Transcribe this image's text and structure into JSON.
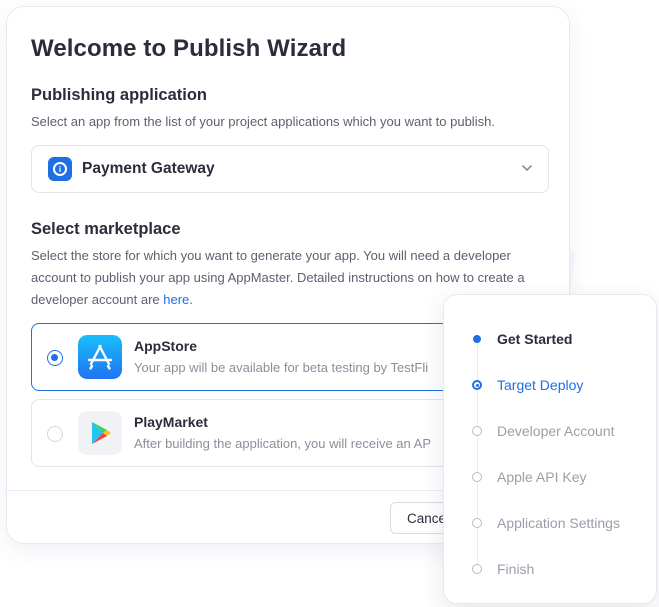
{
  "wizard": {
    "title": "Welcome to Publish Wizard"
  },
  "publishing": {
    "title": "Publishing application",
    "description": "Select an app from the list of your project applications which you want to publish.",
    "selected_app": "Payment Gateway",
    "app_icon": "payment-gateway-icon"
  },
  "marketplace": {
    "title": "Select marketplace",
    "description_part1": "Select the store for which you want to generate your app. You will need a developer account to publish your app using AppMaster. Detailed instructions on how to create a developer account are ",
    "link_text": "here",
    "description_end": ".",
    "options": [
      {
        "name": "AppStore",
        "subtitle": "Your app will be available for beta testing by TestFli",
        "icon": "appstore-icon",
        "selected": true
      },
      {
        "name": "PlayMarket",
        "subtitle": "After building the application, you will receive an AP",
        "icon": "playmarket-icon",
        "selected": false
      }
    ]
  },
  "footer": {
    "cancel_label": "Cancel"
  },
  "steps": [
    {
      "label": "Get Started",
      "state": "done"
    },
    {
      "label": "Target Deploy",
      "state": "active"
    },
    {
      "label": "Developer Account",
      "state": "pending"
    },
    {
      "label": "Apple API Key",
      "state": "pending"
    },
    {
      "label": "Application Settings",
      "state": "pending"
    },
    {
      "label": "Finish",
      "state": "pending"
    }
  ],
  "colors": {
    "accent": "#1f6fe5",
    "text": "#2a2d3a",
    "muted": "#9a9ea9"
  }
}
